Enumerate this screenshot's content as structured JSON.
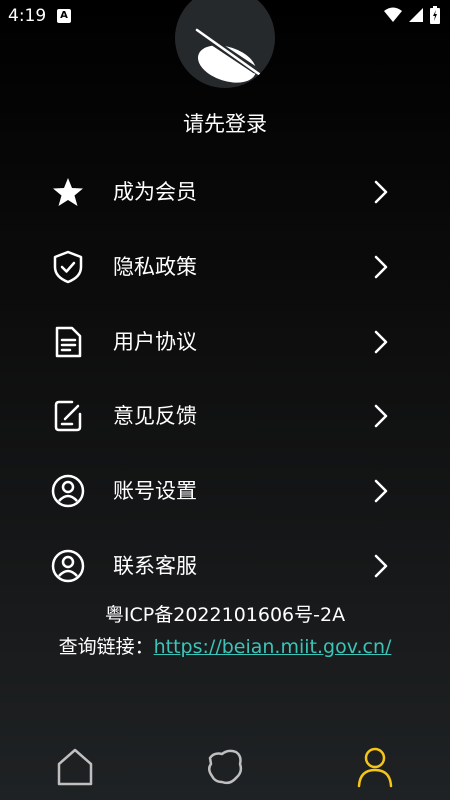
{
  "status": {
    "time": "4:19",
    "indicator": "A"
  },
  "profile": {
    "login_prompt": "请先登录"
  },
  "menu": [
    {
      "label": "成为会员",
      "icon": "star-icon"
    },
    {
      "label": "隐私政策",
      "icon": "shield-check-icon"
    },
    {
      "label": "用户协议",
      "icon": "document-icon"
    },
    {
      "label": "意见反馈",
      "icon": "edit-note-icon"
    },
    {
      "label": "账号设置",
      "icon": "user-circle-icon"
    },
    {
      "label": "联系客服",
      "icon": "user-circle-icon"
    }
  ],
  "footer": {
    "icp": "粤ICP备2022101606号-2A",
    "query_prefix": "查询链接：",
    "query_url": "https://beian.miit.gov.cn/"
  },
  "bottom_nav": [
    {
      "name": "home",
      "icon": "home-icon",
      "active": false
    },
    {
      "name": "discover",
      "icon": "map-icon",
      "active": false
    },
    {
      "name": "profile",
      "icon": "person-icon",
      "active": true
    }
  ],
  "colors": {
    "accent": "#f5c518",
    "link": "#3cc4b8",
    "background": "#000000"
  }
}
